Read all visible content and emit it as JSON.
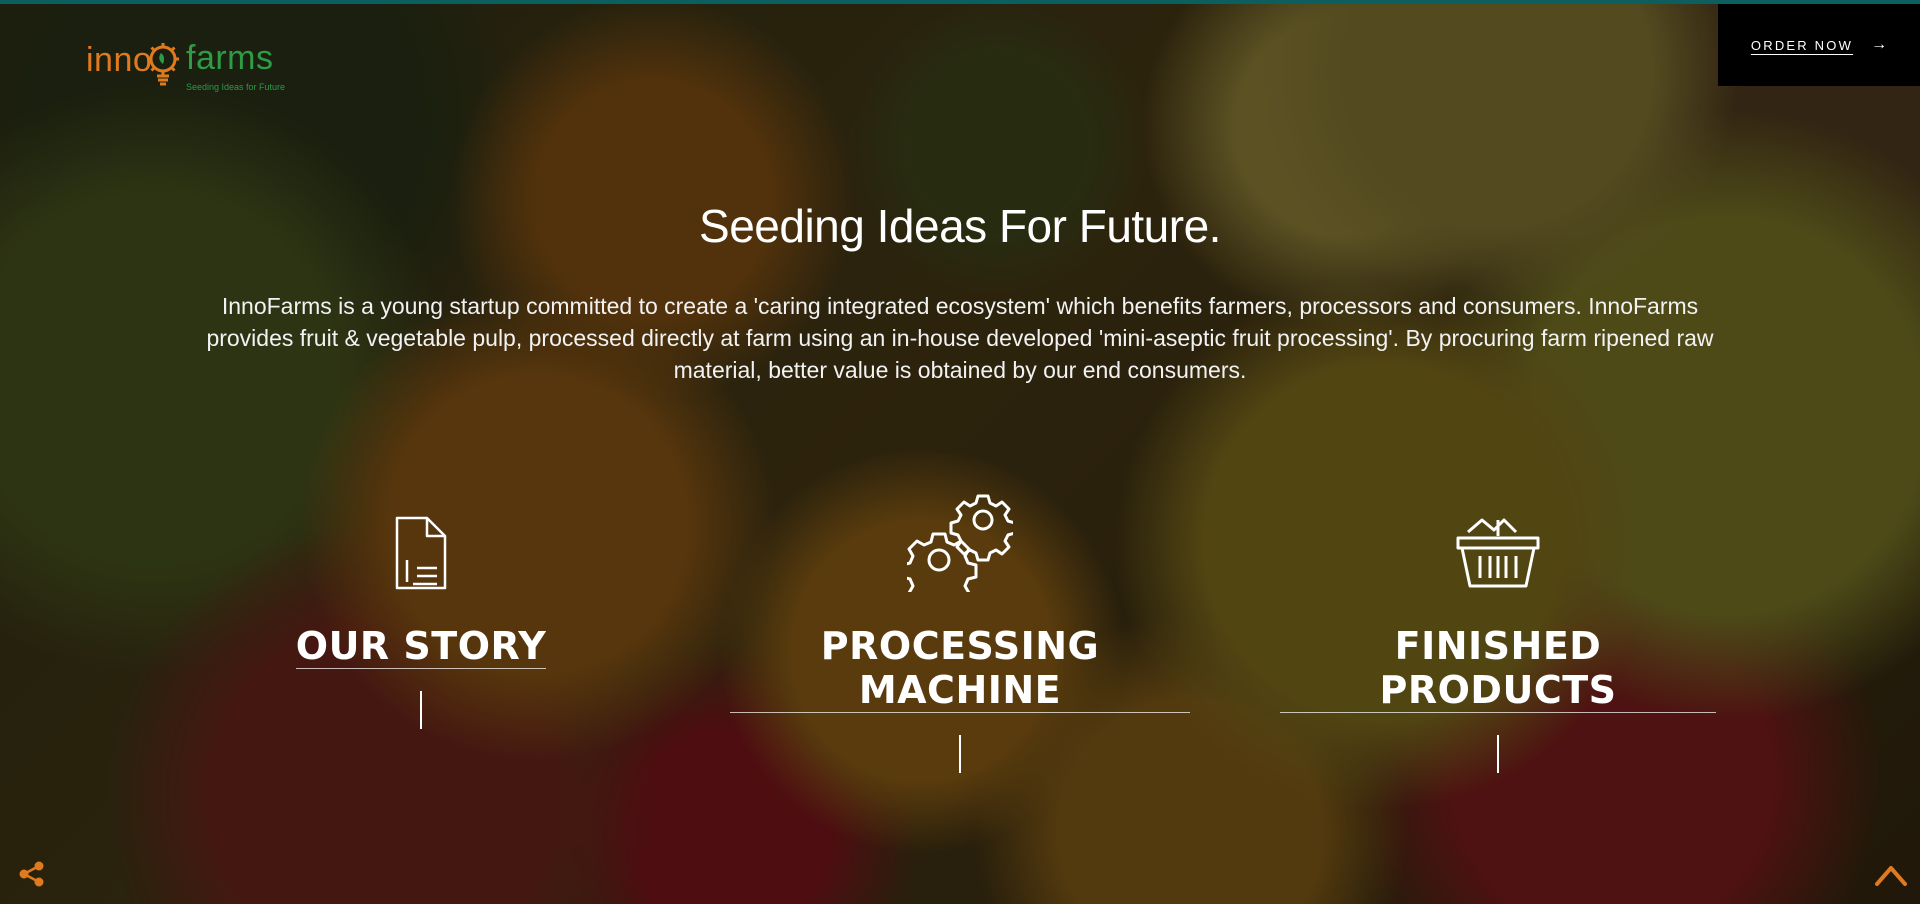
{
  "brand": {
    "logo_part1": "inno",
    "logo_part2": "farms",
    "tagline": "Seeding Ideas for Future"
  },
  "header": {
    "order_label": "ORDER NOW",
    "order_icon": "arrow-right-icon"
  },
  "hero": {
    "headline": "Seeding Ideas For Future.",
    "description": "InnoFarms is a young startup committed to create a 'caring integrated ecosystem' which benefits farmers, processors and consumers. InnoFarms provides fruit & vegetable pulp, processed directly at farm using an in-house developed 'mini-aseptic fruit processing'. By procuring farm ripened raw material, better value is obtained by our end consumers."
  },
  "features": [
    {
      "title": "OUR STORY",
      "icon": "document-icon"
    },
    {
      "title": "PROCESSING MACHINE",
      "icon": "gears-icon"
    },
    {
      "title": "FINISHED PRODUCTS",
      "icon": "basket-icon"
    }
  ],
  "footer": {
    "share_icon": "share-icon",
    "scroll_icon": "chevron-up-icon"
  },
  "colors": {
    "accent_orange": "#e07a1f",
    "brand_green": "#2e9b45",
    "top_bar": "#0b5f5f"
  }
}
